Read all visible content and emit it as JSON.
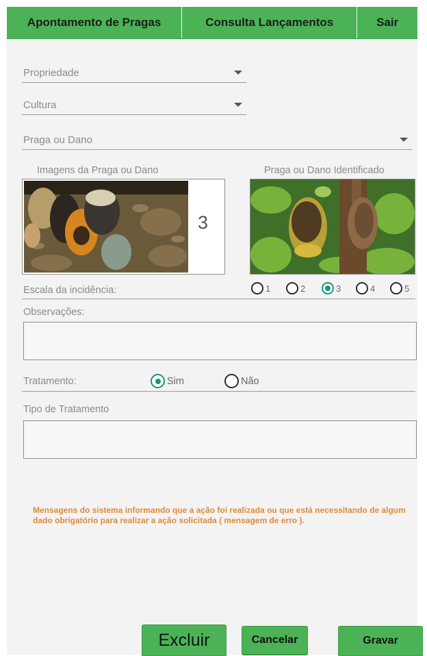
{
  "nav": {
    "tab1": "Apontamento de Pragas",
    "tab2": "Consulta Lançamentos",
    "tab3": "Sair"
  },
  "form": {
    "propriedade": "Propriedade",
    "cultura": "Cultura",
    "praga": "Praga ou Dano"
  },
  "images": {
    "left_label": "Imagens da Praga ou Dano",
    "right_label": "Praga ou Dano Identificado",
    "count": "3"
  },
  "scale": {
    "label": "Escala da incidência:",
    "options": [
      "1",
      "2",
      "3",
      "4",
      "5"
    ],
    "selected": "3"
  },
  "observacoes": {
    "label": "Observações:"
  },
  "tratamento": {
    "label": "Tratamento:",
    "opt_yes": "Sim",
    "opt_no": "Não",
    "selected": "Sim"
  },
  "tipo": {
    "label": "Tipo de Tratamento"
  },
  "system_message": "Mensagens do sistema informando que a ação foi realizada ou que está necessitando de algum dado obrigatório para realizar a ação solicitada ( mensagem de erro ).",
  "buttons": {
    "excluir": "Excluir",
    "cancelar": "Cancelar",
    "gravar": "Gravar"
  },
  "colors": {
    "accent": "#4bb356",
    "radio_selected": "#16967a",
    "message": "#e08a3a"
  }
}
